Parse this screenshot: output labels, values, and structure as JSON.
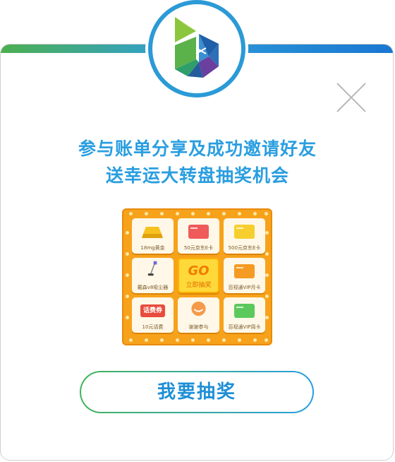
{
  "colors": {
    "accent_blue": "#2a9ee0",
    "accent_green": "#43b35a",
    "board_orange": "#f7a21b",
    "go_yellow": "#ffd93a"
  },
  "header": {
    "logo_icon": "brand-cube-logo"
  },
  "close": {
    "icon": "close-icon"
  },
  "headline": {
    "line1": "参与账单分享及成功邀请好友",
    "line2": "送幸运大转盘抽奖机会"
  },
  "lottery": {
    "prizes": [
      {
        "label": "18mg黄金",
        "icon": "gold-bar-icon"
      },
      {
        "label": "50元京东E卡",
        "icon": "red-card-icon"
      },
      {
        "label": "500元京东E卡",
        "icon": "yellow-card-icon"
      },
      {
        "label": "戴森v8吸尘器",
        "icon": "vacuum-icon"
      },
      {
        "label": "百视通VIP月卡",
        "icon": "orange-card-icon"
      },
      {
        "label": "10元话费",
        "icon": "phone-credit-icon"
      },
      {
        "label": "谢谢参与",
        "icon": "smile-icon"
      },
      {
        "label": "百视通VIP周卡",
        "icon": "green-card-icon"
      }
    ],
    "go_text": "GO",
    "go_sub": "立即抽奖",
    "phone_credit_tag": "话费券"
  },
  "action": {
    "draw_label": "我要抽奖"
  }
}
